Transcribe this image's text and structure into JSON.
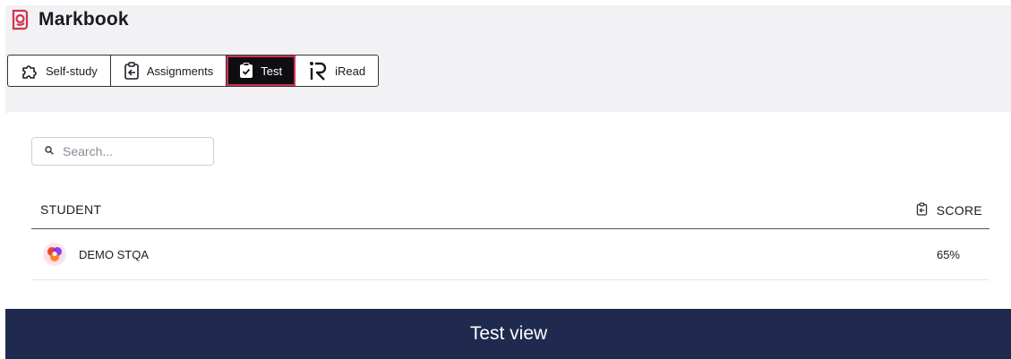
{
  "app": {
    "title": "Markbook"
  },
  "tabs": [
    {
      "label": "Self-study",
      "icon": "puzzle-icon",
      "active": false
    },
    {
      "label": "Assignments",
      "icon": "clipboard-arrow-icon",
      "active": false
    },
    {
      "label": "Test",
      "icon": "clipboard-check-icon",
      "active": true
    },
    {
      "label": "iRead",
      "icon": "iread-logo-icon",
      "active": false
    }
  ],
  "search": {
    "placeholder": "Search...",
    "value": ""
  },
  "table": {
    "headers": {
      "student": "STUDENT",
      "score": "SCORE"
    },
    "rows": [
      {
        "student": "DEMO STQA",
        "score": "65%"
      }
    ]
  },
  "caption": "Test view",
  "colors": {
    "accent": "#d4314d",
    "caption_bg": "#1f2a4e",
    "active_tab_bg": "#0d0d12"
  }
}
